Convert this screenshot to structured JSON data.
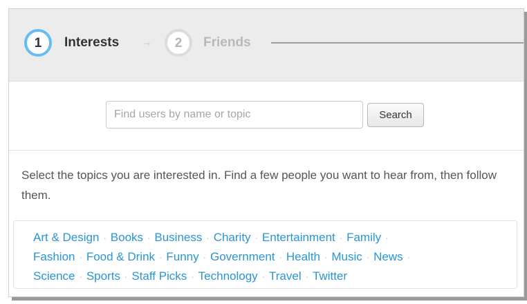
{
  "steps": [
    {
      "number": "1",
      "label": "Interests",
      "state": "active"
    },
    {
      "number": "2",
      "label": "Friends",
      "state": "inactive"
    }
  ],
  "step_arrow": "→",
  "search": {
    "placeholder": "Find users by name or topic",
    "value": "",
    "button_label": "Search"
  },
  "intro_text": "Select the topics you are interested in. Find a few people you want to hear from, then follow them.",
  "topic_separator": "·",
  "topics": [
    "Art & Design",
    "Books",
    "Business",
    "Charity",
    "Entertainment",
    "Family",
    "Fashion",
    "Food & Drink",
    "Funny",
    "Government",
    "Health",
    "Music",
    "News",
    "Science",
    "Sports",
    "Staff Picks",
    "Technology",
    "Travel",
    "Twitter"
  ],
  "colors": {
    "active_step_ring": "#66bdf3",
    "link": "#2a95d3",
    "header_bg": "#ececec"
  }
}
